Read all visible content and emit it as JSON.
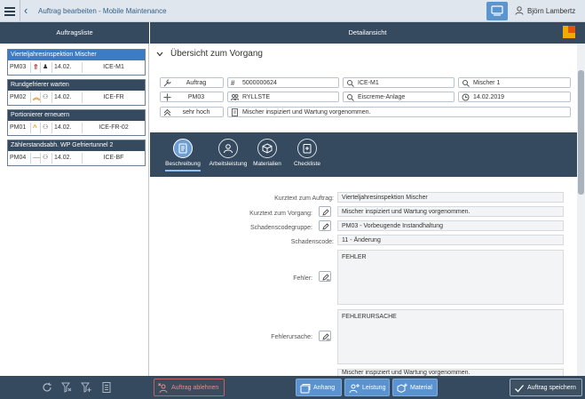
{
  "header": {
    "title": "Auftrag bearbeiten - Mobile Maintenance",
    "user": "Björn Lambertz"
  },
  "columns": {
    "left": "Auftragsliste",
    "right": "Detailansicht"
  },
  "orders": [
    {
      "title": "Vierteljahresinspektion Mischer",
      "type": "PM03",
      "priority": "!!",
      "date": "14.02.",
      "location": "ICE-M1",
      "selected": true
    },
    {
      "title": "Rundgefrierer warten",
      "type": "PM02",
      "priority": "^^",
      "date": "14.02.",
      "location": "ICE-FR",
      "selected": false
    },
    {
      "title": "Portionierer erneuern",
      "type": "PM01",
      "priority": "^",
      "date": "14.02.",
      "location": "ICE-FR-02",
      "selected": false
    },
    {
      "title": "Zählerstandsabh. WP Gefriertunnel 2",
      "type": "PM04",
      "priority": "—",
      "date": "14.02.",
      "location": "ICE-BF",
      "selected": false
    }
  ],
  "overview": {
    "title": "Übersicht zum Vorgang",
    "fields": {
      "auftrag": "Auftrag",
      "order_no": "5000000624",
      "func_loc": "ICE-M1",
      "equipment": "Mischer 1",
      "type": "PM03",
      "planner": "RYLLSTE",
      "plant_desc": "Eiscreme-Anlage",
      "date": "14.02.2019",
      "priority": "sehr hoch",
      "text": "Mischer inspiziert und Wartung vorgenommen."
    }
  },
  "tabs": [
    {
      "label": "Beschreibung",
      "icon": "document-icon",
      "active": true
    },
    {
      "label": "Arbeitsleistung",
      "icon": "person-icon",
      "active": false
    },
    {
      "label": "Materialien",
      "icon": "box-icon",
      "active": false
    },
    {
      "label": "Checkliste",
      "icon": "checklist-icon",
      "active": false
    }
  ],
  "details": {
    "kurztext_auftrag_label": "Kurztext zum Auftrag:",
    "kurztext_auftrag": "Vierteljahresinspektion Mischer",
    "kurztext_vorgang_label": "Kurztext zum Vorgang:",
    "kurztext_vorgang": "Mischer inspiziert und Wartung vorgenommen.",
    "schadenscodegruppe_label": "Schadenscodegruppe:",
    "schadenscodegruppe": "PM03 - Vorbeugende Instandhaltung",
    "schadenscode_label": "Schadenscode:",
    "schadenscode": "11 - Änderung",
    "fehler_label": "Fehler:",
    "fehler": "FEHLER",
    "fehlerursache_label": "Fehlerursache:",
    "fehlerursache": "FEHLERURSACHE",
    "bottom_text": "Mischer inspiziert und Wartung vorgenommen."
  },
  "footer": {
    "reject": "Auftrag ablehnen",
    "anhang": "Anhang",
    "leistung": "Leistung",
    "material": "Material",
    "save": "Auftrag speichern"
  },
  "colors": {
    "dark": "#354a5f",
    "accent": "#5a93cf",
    "selected": "#3b7cc4",
    "danger": "#c16363"
  }
}
